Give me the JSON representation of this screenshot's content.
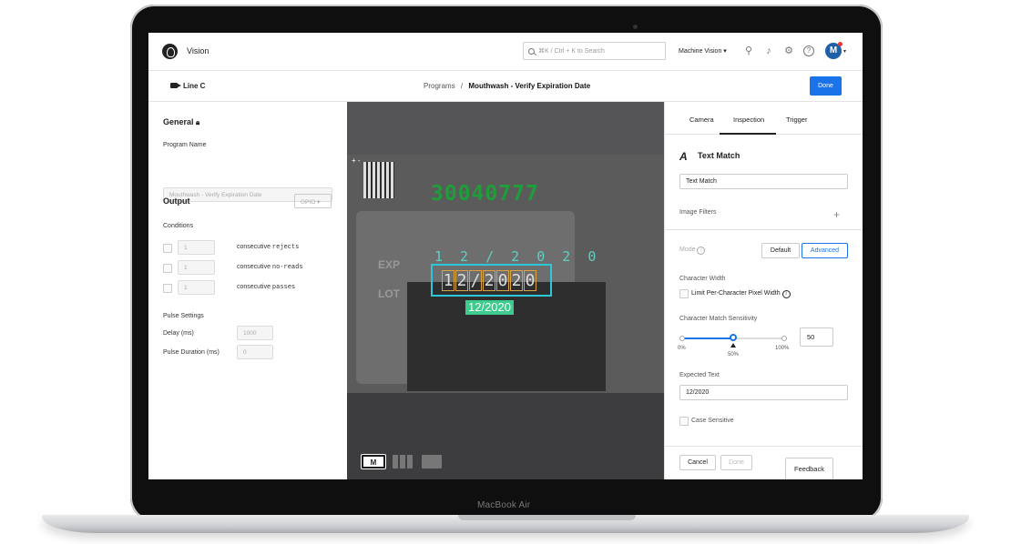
{
  "device": {
    "label": "MacBook Air"
  },
  "header": {
    "app_title": "Vision",
    "search_placeholder": "⌘K / Ctrl + K to Search",
    "workspace": "Machine Vision ▾",
    "avatar_initial": "M"
  },
  "subheader": {
    "line": "Line C",
    "breadcrumb_root": "Programs",
    "breadcrumb_sep": "/",
    "breadcrumb_current": "Mouthwash - Verify Expiration Date",
    "done": "Done"
  },
  "left": {
    "general_title": "General",
    "program_name_label": "Program Name",
    "program_name_value": "Mouthwash - Verify Expiration Date",
    "output_title": "Output",
    "gpio_select": "GPIO ▾",
    "conditions_label": "Conditions",
    "conditions": [
      {
        "value": "1",
        "prefix": "consecutive ",
        "kind": "rejects"
      },
      {
        "value": "1",
        "prefix": "consecutive ",
        "kind": "no-reads"
      },
      {
        "value": "1",
        "prefix": "consecutive ",
        "kind": "passes"
      }
    ],
    "pulse_title": "Pulse Settings",
    "delay_label": "Delay (ms)",
    "delay_value": "1000",
    "pulse_duration_label": "Pulse Duration (ms)",
    "pulse_duration_value": "0"
  },
  "viewer": {
    "zoom_controls": "+ -",
    "lot_number": "30040777",
    "exp_label": "EXP",
    "lot_label": "LOT",
    "ghost_text": "1 2 / 2 0 2 0",
    "roi_chars": [
      "1",
      "2",
      "/",
      "2",
      "0",
      "2",
      "0"
    ],
    "match_text": "12/2020",
    "mode_button": "M"
  },
  "right": {
    "tabs": [
      "Camera",
      "Inspection",
      "Trigger"
    ],
    "active_tab": "Inspection",
    "tool_title": "Text Match",
    "tool_name_value": "Text Match",
    "image_filters_label": "Image Filters",
    "mode_label": "Mode",
    "mode_default": "Default",
    "mode_advanced": "Advanced",
    "char_width_label": "Character Width",
    "limit_label": "Limit Per-Character Pixel Width",
    "sensitivity_label": "Character Match Sensitivity",
    "sensitivity_min": "0%",
    "sensitivity_mid": "50%",
    "sensitivity_max": "100%",
    "sensitivity_value": "50",
    "expected_text_label": "Expected Text",
    "expected_text_value": "12/2020",
    "case_sensitive_label": "Case Sensitive",
    "cancel": "Cancel",
    "done": "Done"
  },
  "feedback": "Feedback",
  "colors": {
    "accent": "#1a73e8",
    "match": "#3ecb8e",
    "roi": "#2ec6d9",
    "lot_green": "#1e9e3a"
  }
}
